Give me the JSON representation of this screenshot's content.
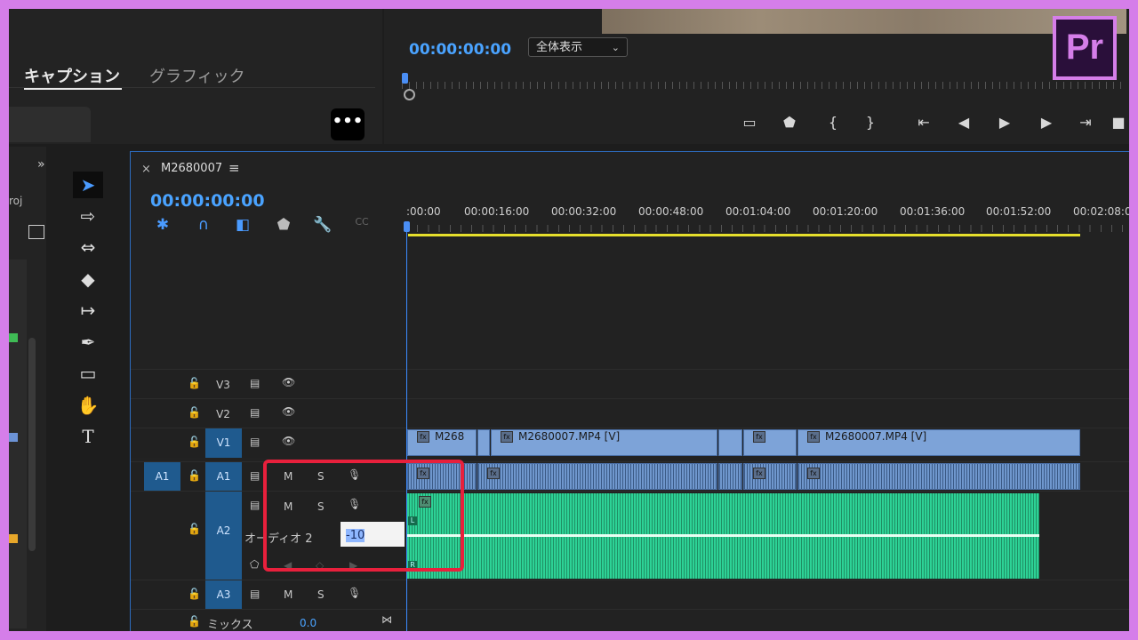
{
  "top_panel": {
    "tabs": [
      {
        "label": "キャプション",
        "active": true
      },
      {
        "label": "グラフィック",
        "active": false
      }
    ],
    "more_label": "•••"
  },
  "program_monitor": {
    "timecode": "00:00:00:00",
    "zoom": "全体表示",
    "logo": "Pr",
    "controls": [
      "safe-margins",
      "marker",
      "in-point",
      "out-point",
      "go-to-in",
      "step-back",
      "play",
      "step-forward",
      "go-to-out"
    ]
  },
  "left_panel": {
    "label": "roj"
  },
  "timeline": {
    "sequence_name": "M2680007",
    "timecode": "00:00:00:00",
    "ruler_labels": [
      ":00:00",
      "00:00:16:00",
      "00:00:32:00",
      "00:00:48:00",
      "00:01:04:00",
      "00:01:20:00",
      "00:01:36:00",
      "00:01:52:00",
      "00:02:08:00"
    ],
    "tracks": {
      "v3": {
        "name": "V3"
      },
      "v2": {
        "name": "V2"
      },
      "v1": {
        "name": "V1"
      },
      "a1": {
        "source": "A1",
        "name": "A1",
        "m": "M",
        "s": "S"
      },
      "a2": {
        "name": "A2",
        "m": "M",
        "s": "S",
        "label": "オーディオ 2",
        "volume": "-10"
      },
      "a3": {
        "name": "A3",
        "m": "M",
        "s": "S"
      },
      "mix": {
        "label": "ミックス",
        "value": "0.0"
      }
    },
    "clips": {
      "v1_short": "M268",
      "v1_main": "M2680007.MP4 [V]",
      "v1_end": "M2680007.MP4 [V]"
    },
    "colors": {
      "accent": "#4aa3ff",
      "video_clip": "#7da3d8",
      "audio_a2": "#2dd296",
      "highlight": "#e8203c",
      "frame": "#d57ee9"
    }
  }
}
